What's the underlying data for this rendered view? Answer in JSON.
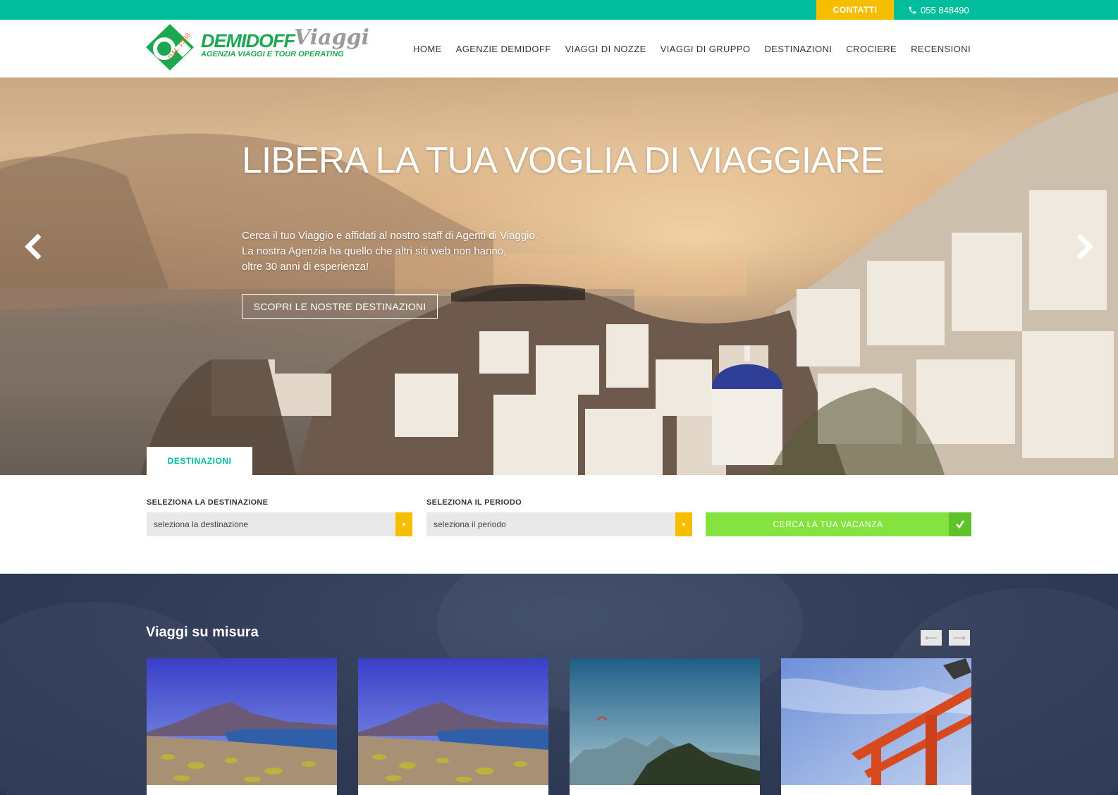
{
  "topbar": {
    "contact_label": "CONTATTI",
    "phone": "055 848490"
  },
  "logo": {
    "brand": "DEMIDOFF",
    "viaggi": "Viaggi",
    "tagline": "AGENZIA VIAGGI E TOUR OPERATING",
    "since": "DAL 1988"
  },
  "nav": {
    "items": [
      {
        "label": "HOME"
      },
      {
        "label": "AGENZIE DEMIDOFF"
      },
      {
        "label": "VIAGGI DI NOZZE"
      },
      {
        "label": "VIAGGI DI GRUPPO"
      },
      {
        "label": "DESTINAZIONI"
      },
      {
        "label": "CROCIERE"
      },
      {
        "label": "RECENSIONI"
      }
    ]
  },
  "hero": {
    "title": "LIBERA LA TUA VOGLIA DI VIAGGIARE",
    "line1": "Cerca il tuo Viaggio e affidati al nostro staff di Agenti di Viaggio.",
    "line2": "La nostra Agenzia ha quello che altri siti web non hanno,",
    "line3": "oltre 30 anni di esperienza!",
    "cta": "SCOPRI LE NOSTRE DESTINAZIONI",
    "prev_icon": "chevron-left-icon",
    "next_icon": "chevron-right-icon"
  },
  "search": {
    "tab_label": "DESTINAZIONI",
    "destination_label": "SELEZIONA LA DESTINAZIONE",
    "destination_value": "seleziona la destinazione",
    "period_label": "SELEZIONA IL PERIODO",
    "period_value": "seleziona il periodo",
    "submit_label": "CERCA LA TUA VACANZA"
  },
  "tours": {
    "title": "Viaggi su misura",
    "prev_icon": "arrow-left-icon",
    "next_icon": "arrow-right-icon"
  },
  "colors": {
    "teal": "#00bd9c",
    "yellow": "#f7be00",
    "green_button": "#84e33f",
    "navy": "#2f3a55",
    "logo_green": "#1ca851"
  }
}
